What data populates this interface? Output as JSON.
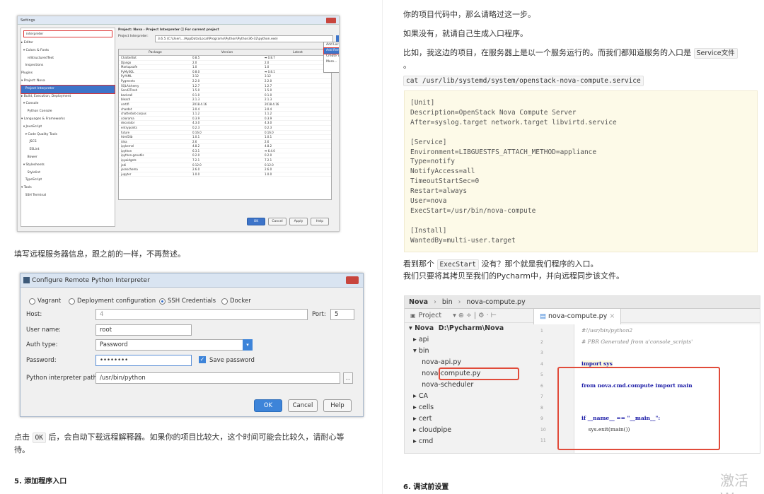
{
  "left": {
    "settings": {
      "title": "Settings",
      "search": "interpreter",
      "tree": [
        "▸ Editor",
        "  ▾ Colors & Fonts",
        "      reStructuredText",
        "    Inspections",
        "Plugins",
        "▾ Project: Nova",
        "    Project Interpreter",
        "▸ Build, Execution, Deployment",
        "  ▾ Console",
        "      Python Console",
        "▾ Languages & Frameworks",
        "  ▾ JavaScript",
        "    ▾ Code Quality Tools",
        "        JSCS",
        "        ESLint",
        "      Bower",
        "  ▾ Stylesheets",
        "      Stylelint",
        "    TypeScript",
        "▾ Tools",
        "    SSH Terminal"
      ],
      "selected_index": 6,
      "header": "Project: Nova › Project Interpreter  ⓘ For current project",
      "interpreter_label": "Project Interpreter:",
      "interpreter_value": "3.6.5 (C:\\User\\...\\AppData\\Local\\Programs\\Python\\Python36-32\\python.exe)",
      "columns": [
        "Package",
        "Version",
        "Latest"
      ],
      "packages": [
        [
          "ChatterBot",
          "0.8.5",
          "➡ 0.8.7"
        ],
        [
          "Django",
          "2.0",
          "2.0"
        ],
        [
          "Markupsafe",
          "1.0",
          "1.0"
        ],
        [
          "PyMySQL",
          "0.8.0",
          "➡ 0.8.1"
        ],
        [
          "PyYAML",
          "3.12",
          "3.12"
        ],
        [
          "Pygments",
          "2.2.0",
          "2.2.0"
        ],
        [
          "SQLAlchemy",
          "1.2.7",
          "1.2.7"
        ],
        [
          "Send2Trash",
          "1.5.0",
          "1.5.0"
        ],
        [
          "backcall",
          "0.1.0",
          "0.1.0"
        ],
        [
          "bleach",
          "2.1.3",
          "2.1.3"
        ],
        [
          "certifi",
          "2018.4.16",
          "2018.4.16"
        ],
        [
          "chardet",
          "3.0.4",
          "3.0.4"
        ],
        [
          "chatterbot-corpus",
          "1.1.2",
          "1.1.2"
        ],
        [
          "colorama",
          "0.3.9",
          "0.3.9"
        ],
        [
          "decorator",
          "4.3.0",
          "4.3.0"
        ],
        [
          "entrypoints",
          "0.2.3",
          "0.2.3"
        ],
        [
          "future",
          "0.16.0",
          "0.16.0"
        ],
        [
          "html5lib",
          "1.0.1",
          "1.0.1"
        ],
        [
          "idna",
          "2.6",
          "2.6"
        ],
        [
          "ipykernel",
          "4.8.2",
          "4.8.2"
        ],
        [
          "ipython",
          "6.3.1",
          "➡ 6.4.0"
        ],
        [
          "ipython-genutils",
          "0.2.0",
          "0.2.0"
        ],
        [
          "ipywidgets",
          "7.2.1",
          "7.2.1"
        ],
        [
          "jedi",
          "0.12.0",
          "0.12.0"
        ],
        [
          "jsonschema",
          "2.6.0",
          "2.6.0"
        ],
        [
          "jupyter",
          "1.0.0",
          "1.0.0"
        ]
      ],
      "menu": [
        "Add Local",
        "Add Remote",
        "Create VirtualEnv",
        "More..."
      ],
      "menu_selected": 1,
      "buttons": [
        "OK",
        "Cancel",
        "Apply",
        "Help"
      ]
    },
    "para1": "填写远程服务器信息，跟之前的一样，不再赘述。",
    "remote": {
      "title": "Configure Remote Python Interpreter",
      "radios": [
        "Vagrant",
        "Deployment configuration",
        "SSH Credentials",
        "Docker"
      ],
      "radio_selected": 2,
      "host_label": "Host:",
      "host_value": "4",
      "port_label": "Port:",
      "port_value": "5",
      "user_label": "User name:",
      "user_value": "root",
      "auth_label": "Auth type:",
      "auth_value": "Password",
      "pass_label": "Password:",
      "pass_value": "••••••••",
      "save_label": "Save password",
      "path_label": "Python interpreter path:",
      "path_value": "/usr/bin/python",
      "buttons": [
        "OK",
        "Cancel",
        "Help"
      ]
    },
    "para2_a": "点击",
    "para2_code": "OK",
    "para2_b": "后，会自动下载远程解释器。如果你的项目比较大，这个时间可能会比较久，请耐心等",
    "para2_c": "待。",
    "heading": "5. 添加程序入口"
  },
  "right": {
    "p1": "你的项目代码中，那么请略过这一步。",
    "p2": "如果没有，就请自己生成入口程序。",
    "p3_a": "比如，我这边的项目，在服务器上是以一个服务运行的。而我们都知道服务的入口是",
    "p3_code": "Service文件",
    "p3_b": "。",
    "cmd": "cat /usr/lib/systemd/system/openstack-nova-compute.service",
    "code": "[Unit]\nDescription=OpenStack Nova Compute Server\nAfter=syslog.target network.target libvirtd.service\n\n[Service]\nEnvironment=LIBGUESTFS_ATTACH_METHOD=appliance\nType=notify\nNotifyAccess=all\nTimeoutStartSec=0\nRestart=always\nUser=nova\nExecStart=/usr/bin/nova-compute\n\n[Install]\nWantedBy=multi-user.target",
    "p4_a": "看到那个",
    "p4_code": "ExecStart",
    "p4_b": "没有？那个就是我们程序的入口。",
    "p5": "我们只要将其拷贝至我们的Pycharm中，并向远程同步该文件。",
    "pycharm": {
      "nav": [
        "Nova",
        "bin",
        "nova-compute.py"
      ],
      "project_label": "Project",
      "tab": "nova-compute.py",
      "tree": [
        "▾ Nova  D:\\Pycharm\\Nova",
        "  ▸ api",
        "  ▾ bin",
        "      nova-api.py",
        "      nova-compute.py",
        "      nova-scheduler",
        "  ▸ CA",
        "  ▸ cells",
        "  ▸ cert",
        "  ▸ cloudpipe",
        "  ▸ cmd"
      ],
      "lines": [
        "#!/usr/bin/python2",
        "# PBR Generated from u'console_scripts'",
        "",
        "import sys",
        "",
        "from nova.cmd.compute import main",
        "",
        "",
        "if __name__ == \"__main__\":",
        "    sys.exit(main())",
        ""
      ],
      "line_numbers": [
        "1",
        "2",
        "3",
        "4",
        "5",
        "6",
        "7",
        "8",
        "9",
        "10",
        "11"
      ]
    },
    "heading": "6. 调试前设置",
    "watermark": "激活 W"
  }
}
